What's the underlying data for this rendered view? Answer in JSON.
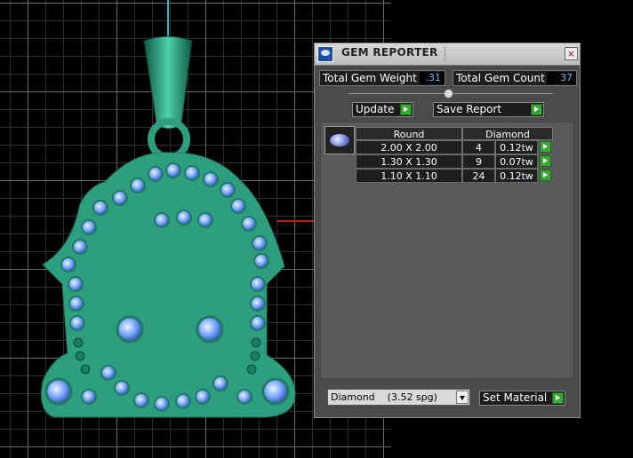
{
  "panel": {
    "title": "GEM REPORTER",
    "close_label": "×",
    "total_weight_label": "Total Gem Weight",
    "total_weight_value": ".31",
    "total_count_label": "Total Gem Count",
    "total_count_value": "37",
    "update_label": "Update",
    "save_report_label": "Save Report",
    "table": {
      "shape_header": "Round",
      "material_header": "Diamond",
      "rows": [
        {
          "size": "2.00 X 2.00",
          "count": "4",
          "weight": "0.12tw"
        },
        {
          "size": "1.30 X 1.30",
          "count": "9",
          "weight": "0.07tw"
        },
        {
          "size": "1.10 X 1.10",
          "count": "24",
          "weight": "0.12tw"
        }
      ]
    },
    "material_select": "Diamond    (3.52 spg)",
    "set_material_label": "Set Material"
  },
  "colors": {
    "metal": "#2d9e7e",
    "gem": "#7aa8ff",
    "panel_bg": "#4b4b4b",
    "value_text": "#4ec3ff",
    "accent_button": "#3aa835"
  },
  "icons": {
    "app": "gem-reporter-icon",
    "close": "close-icon",
    "go": "green-arrow-icon",
    "dropdown": "chevron-down-icon",
    "gem": "round-diamond-icon"
  }
}
